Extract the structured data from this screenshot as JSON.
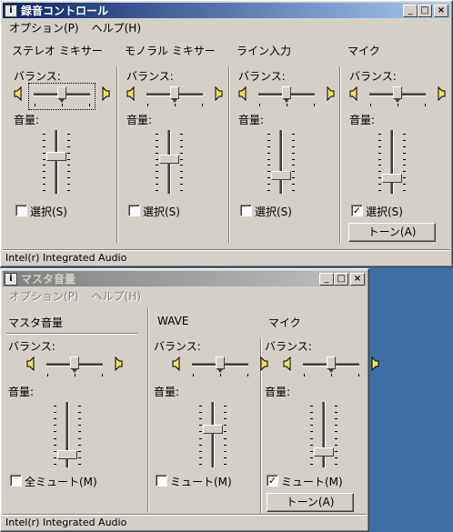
{
  "recording": {
    "title": "録音コントロール",
    "menu": [
      "オプション(P)",
      "ヘルプ(H)"
    ],
    "status": "Intel(r) Integrated Audio",
    "balance_label": "バランス:",
    "volume_label": "音量:",
    "select_label": "選択(S)",
    "tone_label": "トーン(A)",
    "channels": [
      {
        "name": "ステレオ ミキサー",
        "balance": 0.5,
        "volume": 0.6,
        "selected": false
      },
      {
        "name": "モノラル ミキサー",
        "balance": 0.5,
        "volume": 0.55,
        "selected": false
      },
      {
        "name": "ライン入力",
        "balance": 0.5,
        "volume": 0.25,
        "selected": false
      },
      {
        "name": "マイク",
        "balance": 0.5,
        "volume": 0.2,
        "selected": true
      }
    ]
  },
  "master": {
    "title": "マスタ音量",
    "menu": [
      "オプション(P)",
      "ヘルプ(H)"
    ],
    "status": "Intel(r) Integrated Audio",
    "balance_label": "バランス:",
    "volume_label": "音量:",
    "tone_label": "トーン(A)",
    "channels": [
      {
        "name": "マスタ音量",
        "mute_label": "全ミュート(M)",
        "muted": false,
        "balance": 0.5,
        "volume": 0.15
      },
      {
        "name": "WAVE",
        "mute_label": "ミュート(M)",
        "muted": false,
        "balance": 0.5,
        "volume": 0.6
      },
      {
        "name": "マイク",
        "mute_label": "ミュート(M)",
        "muted": true,
        "balance": 0.5,
        "volume": 0.2
      }
    ]
  }
}
